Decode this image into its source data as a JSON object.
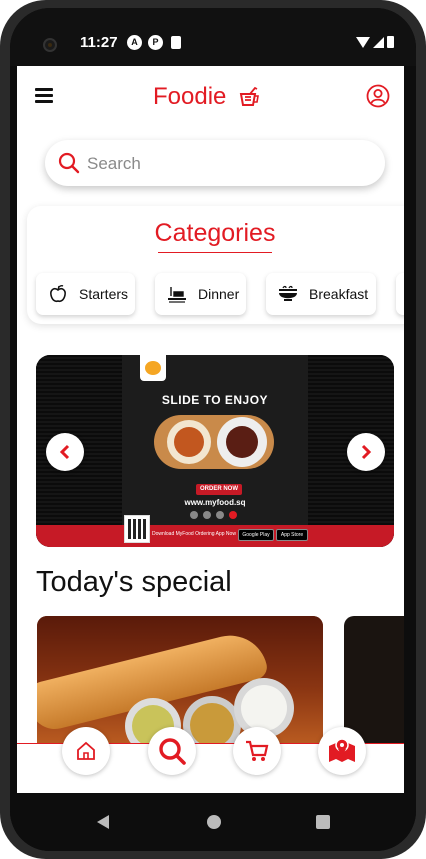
{
  "status_bar": {
    "time": "11:27",
    "icon_a": "A",
    "icon_p": "P"
  },
  "app_bar": {
    "title": "Foodie"
  },
  "search": {
    "placeholder": "Search"
  },
  "categories": {
    "title": "Categories",
    "items": [
      {
        "label": "Starters",
        "icon": "apple-icon"
      },
      {
        "label": "Dinner",
        "icon": "dinner-icon"
      },
      {
        "label": "Breakfast",
        "icon": "bowl-icon"
      }
    ]
  },
  "banner": {
    "heading": "SLIDE TO ENJOY",
    "cta": "ORDER NOW",
    "url": "www.myfood.sq",
    "download_text": "Download MyFood Ordering App Now",
    "store_google": "Google Play",
    "store_apple": "App Store",
    "dots_total": 4,
    "active_dot": 4
  },
  "special": {
    "title": "Today's special"
  },
  "bottom_nav": [
    {
      "name": "home",
      "icon": "home-icon"
    },
    {
      "name": "search",
      "icon": "search-icon"
    },
    {
      "name": "cart",
      "icon": "cart-icon"
    },
    {
      "name": "map",
      "icon": "map-icon"
    }
  ],
  "colors": {
    "accent": "#e21b23"
  }
}
